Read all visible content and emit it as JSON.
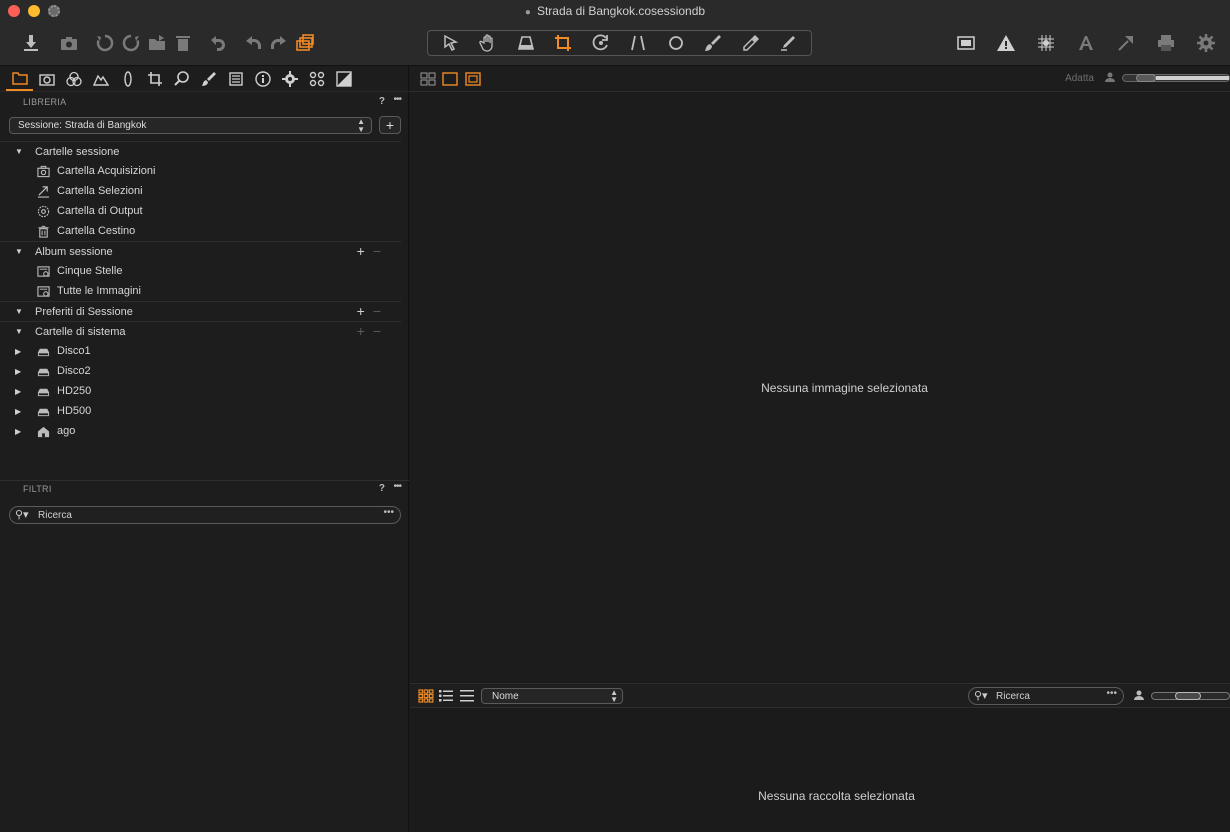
{
  "window": {
    "title": "Strada di Bangkok.cosessiondb"
  },
  "toolbar": {
    "left_icons": [
      "import-icon",
      "camera-icon",
      "rotate-left-icon",
      "rotate-right-icon",
      "move-to-icon",
      "trash-icon",
      "undo-icon",
      "undo-icon",
      "redo-icon",
      "stack-icon"
    ],
    "center_icons": [
      "pointer-icon",
      "hand-icon",
      "keystone-icon",
      "crop-icon",
      "rotate-icon",
      "straighten-icon",
      "circle-icon",
      "brush-icon",
      "eyedropper-icon",
      "picker-icon"
    ],
    "right_icons": [
      "overlay-icon",
      "warning-icon",
      "grid-icon",
      "text-icon",
      "expand-icon",
      "print-icon",
      "settings-icon"
    ]
  },
  "library": {
    "header": "LIBRERIA",
    "help": "?",
    "more": "•••",
    "session_select": "Sessione: Strada di Bangkok",
    "add_label": "+",
    "tree": [
      {
        "kind": "group",
        "label": "Cartelle sessione",
        "expanded": true,
        "actions": false
      },
      {
        "kind": "child",
        "label": "Cartella Acquisizioni",
        "icon": "camera-icon"
      },
      {
        "kind": "child",
        "label": "Cartella Selezioni",
        "icon": "selects-icon"
      },
      {
        "kind": "child",
        "label": "Cartella di Output",
        "icon": "output-icon"
      },
      {
        "kind": "child",
        "label": "Cartella Cestino",
        "icon": "trash-icon"
      },
      {
        "kind": "group",
        "label": "Album sessione",
        "expanded": true,
        "actions": true,
        "actions_enabled": [
          true,
          false
        ]
      },
      {
        "kind": "child",
        "label": "Cinque Stelle",
        "icon": "smart-album-icon"
      },
      {
        "kind": "child",
        "label": "Tutte le Immagini",
        "icon": "smart-album-icon"
      },
      {
        "kind": "group",
        "label": "Preferiti di Sessione",
        "expanded": true,
        "actions": true,
        "actions_enabled": [
          true,
          false
        ]
      },
      {
        "kind": "group",
        "label": "Cartelle di sistema",
        "expanded": true,
        "actions": true,
        "actions_enabled": [
          false,
          false
        ]
      },
      {
        "kind": "drive",
        "label": "Disco1",
        "icon": "drive-icon"
      },
      {
        "kind": "drive",
        "label": "Disco2",
        "icon": "drive-icon"
      },
      {
        "kind": "drive",
        "label": "HD250",
        "icon": "drive-icon"
      },
      {
        "kind": "drive",
        "label": "HD500",
        "icon": "drive-icon"
      },
      {
        "kind": "drive",
        "label": "ago",
        "icon": "home-icon"
      }
    ]
  },
  "filters": {
    "header": "FILTRI",
    "help": "?",
    "more": "•••",
    "search_placeholder": "Ricerca"
  },
  "viewer": {
    "zoom_label": "Adatta",
    "empty_message": "Nessuna immagine selezionata",
    "zoom_level": 0.15
  },
  "browser": {
    "sort_value": "Nome",
    "search_placeholder": "Ricerca",
    "empty_message": "Nessuna raccolta selezionata",
    "thumb_size": 0.45
  },
  "colors": {
    "accent": "#f08a25",
    "background": "#1b1b1b",
    "text": "#c8c8c8"
  }
}
